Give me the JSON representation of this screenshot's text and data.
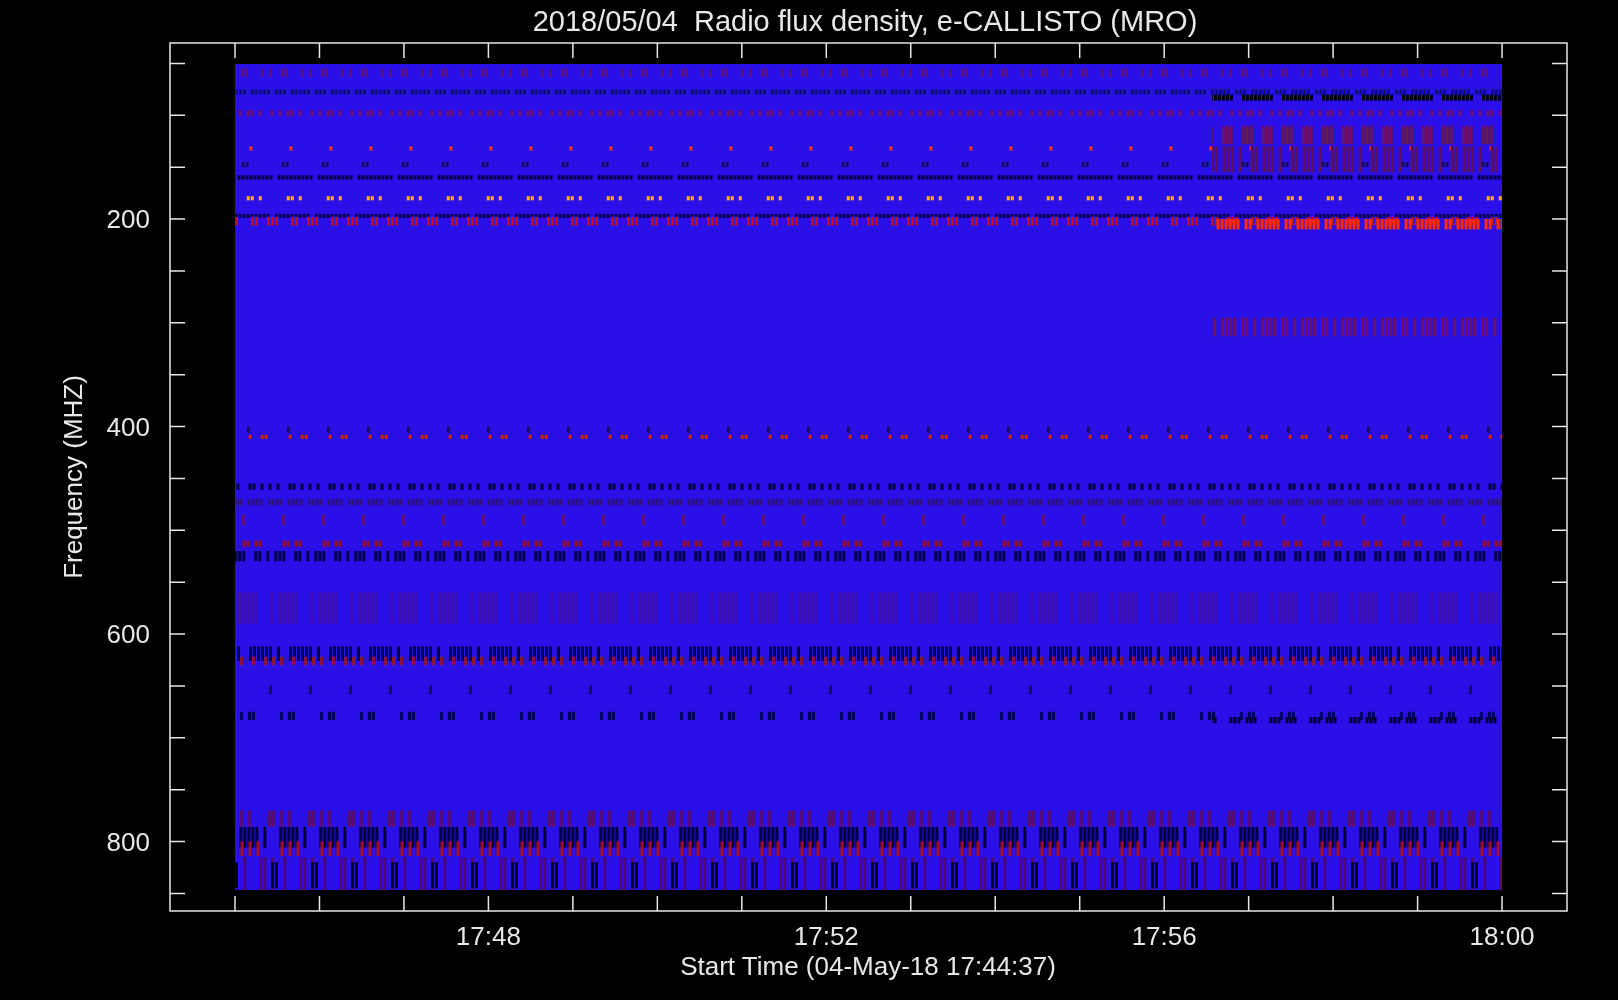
{
  "title": "2018/05/04  Radio flux density, e-CALLISTO (MRO)",
  "y_axis": {
    "label": "Frequency (MHZ)",
    "ticks": [
      "200",
      "400",
      "600",
      "800"
    ]
  },
  "x_axis": {
    "label": "Start Time (04-May-18 17:44:37)",
    "ticks": [
      "17:48",
      "17:52",
      "17:56",
      "18:00"
    ]
  }
}
